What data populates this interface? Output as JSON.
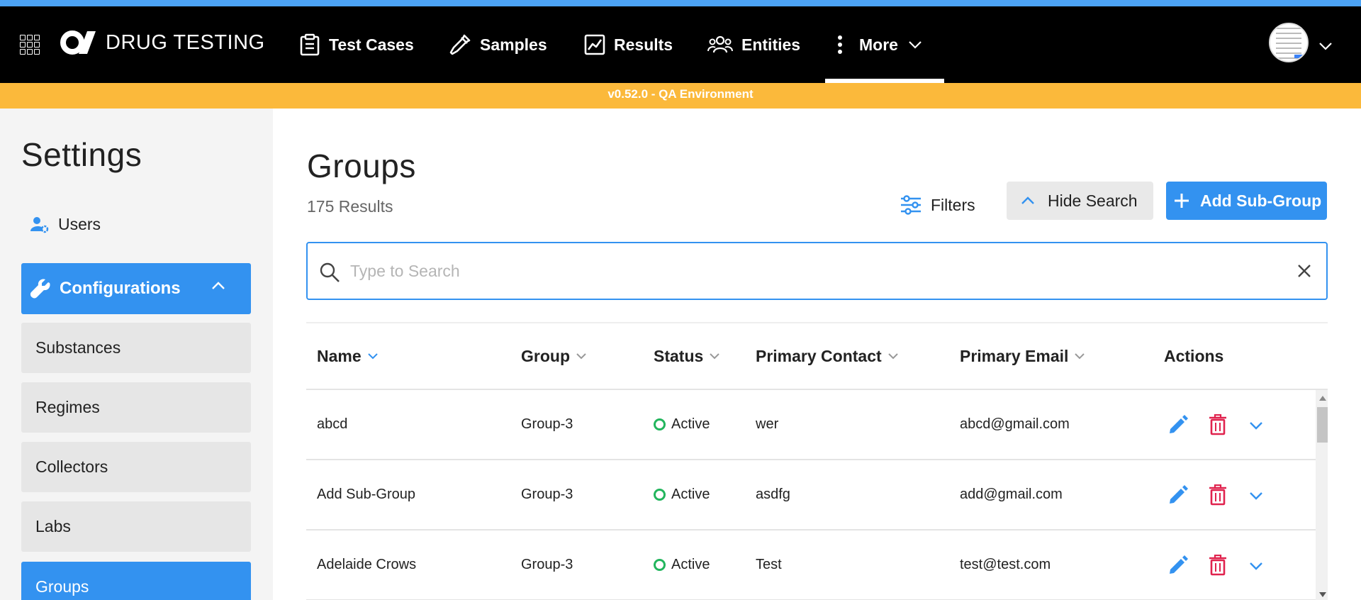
{
  "app": {
    "brand": "DRUG TESTING",
    "env_banner": "v0.52.0 - QA Environment"
  },
  "nav": {
    "items": [
      {
        "label": "Test Cases",
        "icon": "clipboard-icon"
      },
      {
        "label": "Samples",
        "icon": "dropper-icon"
      },
      {
        "label": "Results",
        "icon": "chart-icon"
      },
      {
        "label": "Entities",
        "icon": "people-icon"
      },
      {
        "label": "More",
        "icon": "vertical-dots-icon"
      }
    ]
  },
  "sidebar": {
    "title": "Settings",
    "users_label": "Users",
    "config_label": "Configurations",
    "sub_items": [
      "Substances",
      "Regimes",
      "Collectors",
      "Labs",
      "Groups"
    ],
    "active_item": "Groups"
  },
  "main": {
    "title": "Groups",
    "results_count": "175 Results",
    "filters_label": "Filters",
    "hide_search_label": "Hide Search",
    "add_label": "Add Sub-Group",
    "search_placeholder": "Type to Search",
    "search_value": ""
  },
  "table": {
    "columns": [
      "Name",
      "Group",
      "Status",
      "Primary Contact",
      "Primary Email",
      "Actions"
    ],
    "rows": [
      {
        "name": "abcd",
        "group": "Group-3",
        "status": "Active",
        "contact": "wer",
        "email": "abcd@gmail.com"
      },
      {
        "name": "Add Sub-Group",
        "group": "Group-3",
        "status": "Active",
        "contact": "asdfg",
        "email": "add@gmail.com"
      },
      {
        "name": "Adelaide Crows",
        "group": "Group-3",
        "status": "Active",
        "contact": "Test",
        "email": "test@test.com"
      }
    ]
  },
  "colors": {
    "accent": "#3392f0",
    "banner": "#fbb93b",
    "status_active": "#22b55d",
    "delete": "#e0234e"
  }
}
